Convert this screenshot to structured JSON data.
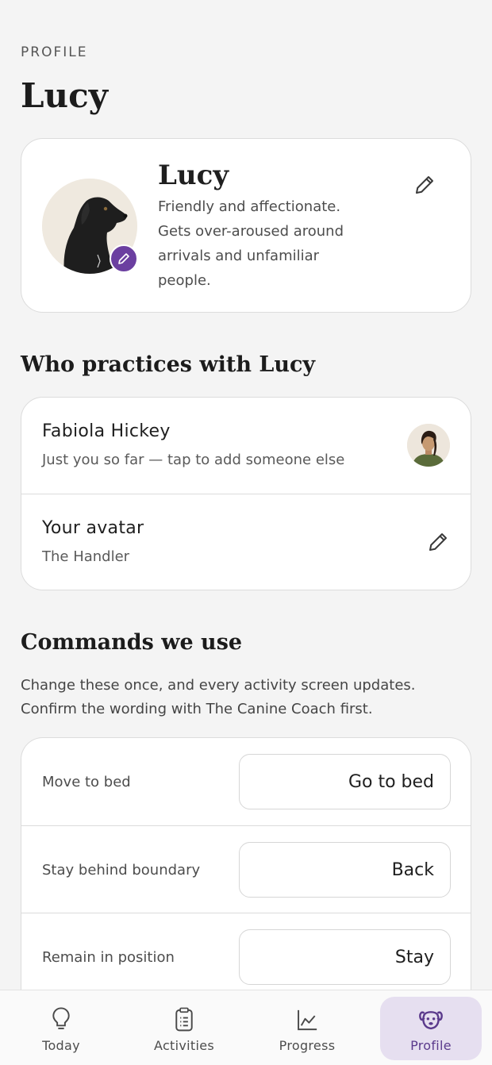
{
  "header": {
    "eyebrow": "PROFILE",
    "title": "Lucy"
  },
  "dog": {
    "name": "Lucy",
    "description": "Friendly and affectionate. Gets over-aroused around arrivals and unfamiliar people."
  },
  "practice": {
    "title": "Who practices with Lucy",
    "person_name": "Fabiola Hickey",
    "person_sub": "Just you so far — tap to add someone else",
    "avatar_title": "Your avatar",
    "avatar_sub": "The Handler"
  },
  "commands": {
    "title": "Commands we use",
    "description": "Change these once, and every activity screen updates. Confirm the wording with The Canine Coach first.",
    "items": [
      {
        "label": "Move to bed",
        "value": "Go to bed"
      },
      {
        "label": "Stay behind boundary",
        "value": "Back"
      },
      {
        "label": "Remain in position",
        "value": "Stay"
      }
    ]
  },
  "nav": {
    "items": [
      {
        "label": "Today",
        "icon": "lightbulb-icon"
      },
      {
        "label": "Activities",
        "icon": "clipboard-icon"
      },
      {
        "label": "Progress",
        "icon": "chart-icon"
      },
      {
        "label": "Profile",
        "icon": "dog-face-icon"
      }
    ],
    "active": "Profile"
  },
  "colors": {
    "accent": "#6b3fa0",
    "active_nav_bg": "#e6dff0",
    "background": "#f4f4f4"
  }
}
